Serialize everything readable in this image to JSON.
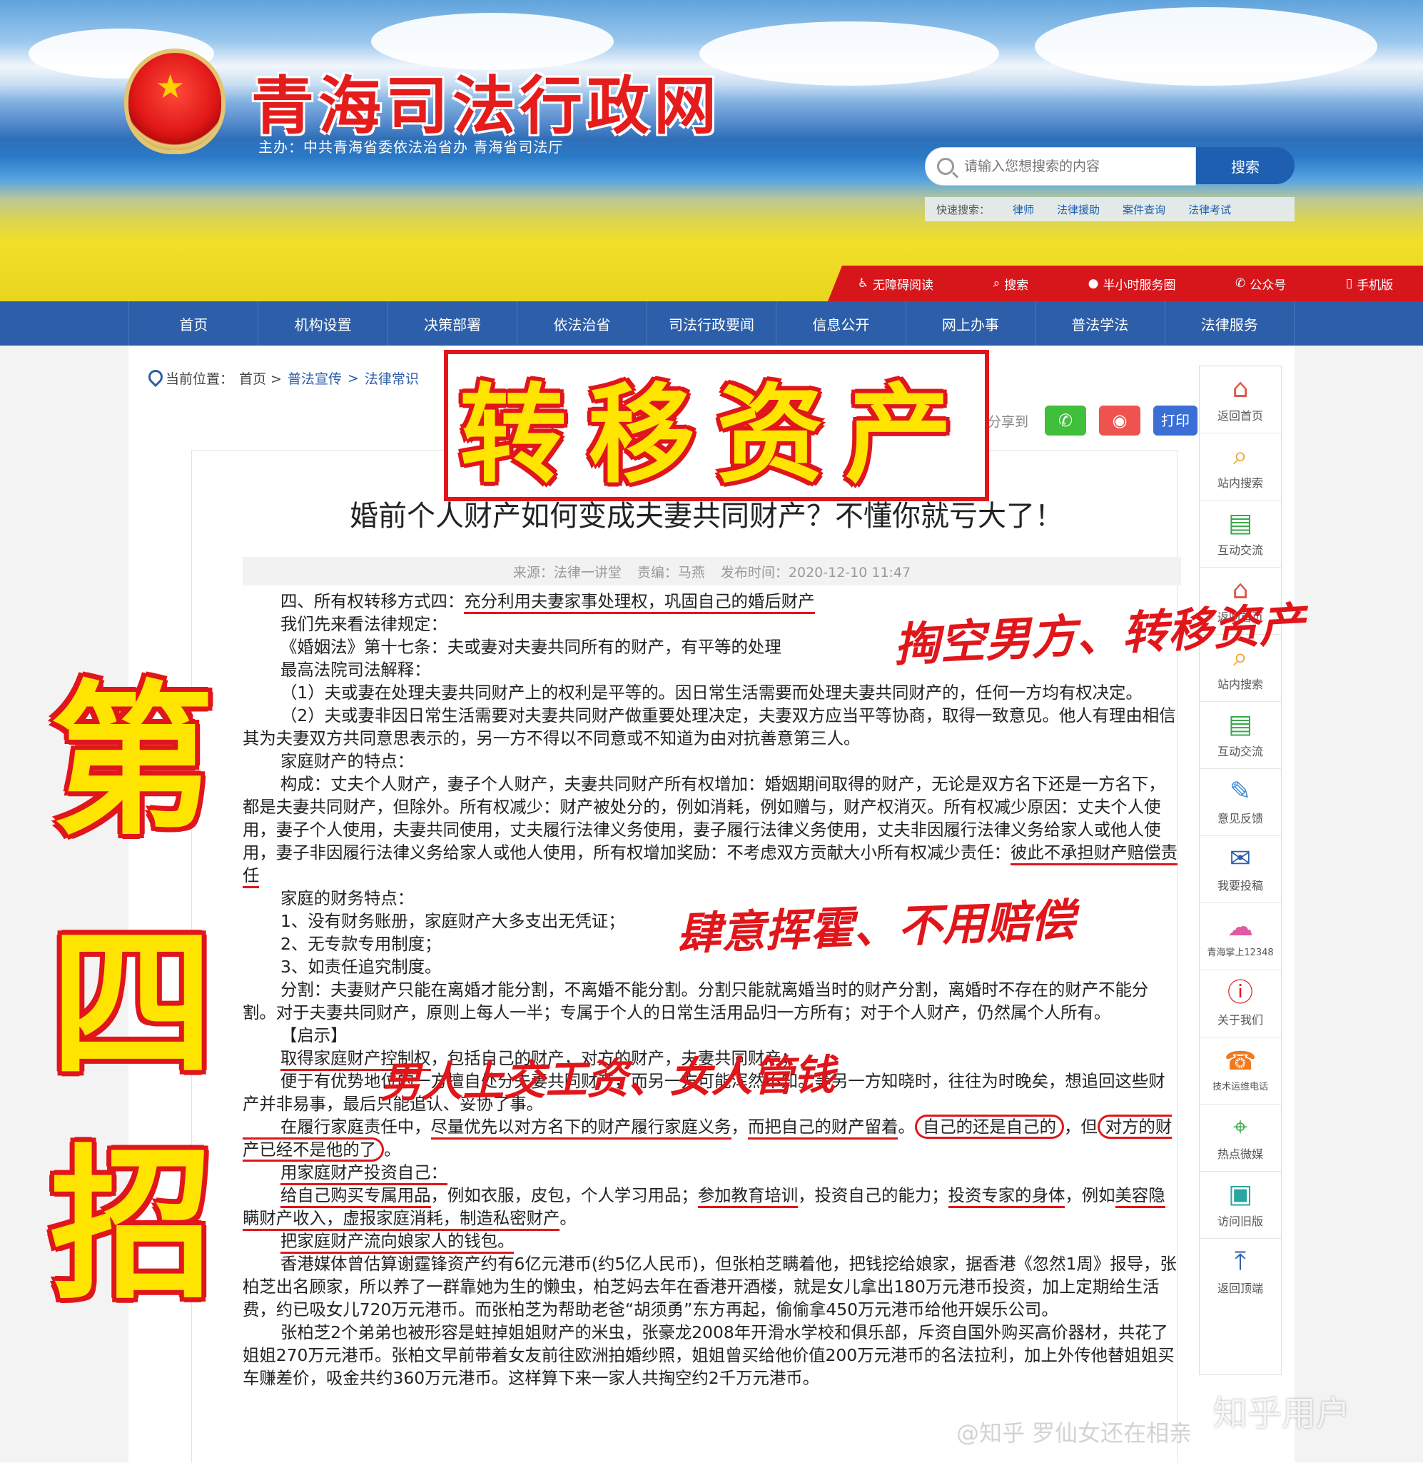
{
  "site": {
    "title": "青海司法行政网",
    "host": "主办：中共青海省委依法治省办  青海省司法厅"
  },
  "search": {
    "placeholder": "请输入您想搜索的内容",
    "button": "搜索",
    "quick_label": "快速搜索：",
    "quick_links": [
      "律师",
      "法律援助",
      "案件查询",
      "法律考试"
    ]
  },
  "util_bar": [
    "无障碍阅读",
    "搜索",
    "半小时服务圈",
    "公众号",
    "手机版"
  ],
  "nav": [
    "首页",
    "机构设置",
    "决策部署",
    "依法治省",
    "司法行政要闻",
    "信息公开",
    "网上办事",
    "普法学法",
    "法律服务"
  ],
  "breadcrumb": {
    "label": "当前位置：",
    "home": "首页 >",
    "l1": "普法宣传",
    "sep": ">",
    "l2": "法律常识"
  },
  "share": {
    "label": "分享到",
    "print": "打印"
  },
  "article": {
    "title": "婚前个人财产如何变成夫妻共同财产？不懂你就亏大了！",
    "source": "来源：法律一讲堂",
    "editor": "责编：马燕",
    "time": "发布时间：2020-12-10 11:47",
    "p1a": "四、所有权转移方式四：",
    "p1b": "充分利用夫妻家事处理权，巩固自己的婚后财产",
    "p2": "我们先来看法律规定：",
    "p3": "《婚姻法》第十七条：夫或妻对夫妻共同所有的财产，有平等的处理",
    "p4": "最高法院司法解释：",
    "p5": "（1）夫或妻在处理夫妻共同财产上的权利是平等的。因日常生活需要而处理夫妻共同财产的，任何一方均有权决定。",
    "p6": "（2）夫或妻非因日常生活需要对夫妻共同财产做重要处理决定，夫妻双方应当平等协商，取得一致意见。他人有理由相信其为夫妻双方共同意思表示的，另一方不得以不同意或不知道为由对抗善意第三人。",
    "p7": "家庭财产的特点：",
    "p8a": "构成：丈夫个人财产，妻子个人财产，夫妻共同财产所有权增加：婚姻期间取得的财产，无论是双方名下还是一方名下，都是夫妻共同财产，但除外。所有权减少：财产被处分的，例如消耗，例如赠与，财产权消灭。所有权减少原因：丈夫个人使用，妻子个人使用，夫妻共同使用，丈夫履行法律义务使用，妻子履行法律义务使用，丈夫非因履行法律义务给家人或他人使用，妻子非因履行法律义务给家人或他人使用，所有权增加奖励：不考虑双方贡献大小所有权减少责任：",
    "p8b": "彼此不承担财产赔偿责任",
    "p9": "家庭的财务特点：",
    "p10": "1、没有财务账册，家庭财产大多支出无凭证；",
    "p11": "2、无专款专用制度；",
    "p12": "3、如责任追究制度。",
    "p13": "分割：夫妻财产只能在离婚才能分割，不离婚不能分割。分割只能就离婚当时的财产分割，离婚时不存在的财产不能分割。对于夫妻共同财产，原则上每人一半；专属于个人的日常生活用品归一方所有；对于个人财产，仍然属个人所有。",
    "p14": "【启示】",
    "p15a": "取得家庭财产控制权",
    "p15b": "，包括自己的财产，对方的财产，夫妻共同财产；",
    "p16": "便于有优势地位的一方擅自处分夫妻共同财产，而另一方可能浑然不知。等另一方知晓时，往往为时晚矣，想追回这些财产并非易事，最后只能追认、妥协了事。",
    "p17a": "在履行家庭责任中，",
    "p17b": "尽量优先以对方名下的财产履行家庭义务",
    "p17c": "，",
    "p17d": "而把自己的财产留着",
    "p17e": "。",
    "p17f": "自己的还是自己的",
    "p17g": "，但",
    "p17h": "对方的财产已经不是他的了",
    "p17i": "。",
    "p18": "用家庭财产投资自己：",
    "p19a": "给自己购买专属用品",
    "p19b": "，例如衣服，皮包，个人学习用品；",
    "p19c": "参加教育培训",
    "p19d": "，投资自己的能力；",
    "p19e": "投资专家的身体",
    "p19f": "，例如",
    "p19g": "美容隐瞒财产收入，虚报家庭消耗，制造私密财产",
    "p19h": "。",
    "p20": "把家庭财产流向娘家人的钱包。",
    "p21": "香港媒体曾估算谢霆锋资产约有6亿元港币(约5亿人民币)，但张柏芝瞒着他，把钱挖给娘家，据香港《忽然1周》报导，张柏芝出名顾家，所以养了一群靠她为生的懒虫，柏芝妈去年在香港开酒楼，就是女儿拿出180万元港币投资，加上定期给生活费，约已吸女儿720万元港币。而张柏芝为帮助老爸“胡须勇”东方再起，偷偷拿450万元港币给他开娱乐公司。",
    "p22": "张柏芝2个弟弟也被形容是蛀掉姐姐财产的米虫，张豪龙2008年开滑水学校和俱乐部，斥资自国外购买高价器材，共花了姐姐270万元港币。张柏文早前带着女友前往欧洲拍婚纱照，姐姐曾买给他价值200万元港币的名法拉利，加上外传他替姐姐买车赚差价，吸金共约360万元港币。这样算下来一家人共掏空约2千万元港币。"
  },
  "sidebar": [
    {
      "label": "返回首页",
      "icon": "home-icon"
    },
    {
      "label": "站内搜索",
      "icon": "search-icon"
    },
    {
      "label": "互动交流",
      "icon": "chat-icon"
    },
    {
      "label": "返回首页",
      "icon": "home-icon"
    },
    {
      "label": "站内搜索",
      "icon": "search-icon"
    },
    {
      "label": "互动交流",
      "icon": "chat-icon"
    },
    {
      "label": "意见反馈",
      "icon": "feedback-icon"
    },
    {
      "label": "我要投稿",
      "icon": "mail-icon"
    },
    {
      "label": "青海掌上12348",
      "icon": "bubble-icon"
    },
    {
      "label": "关于我们",
      "icon": "info-icon"
    },
    {
      "label": "技术运维电话",
      "icon": "phone-icon"
    },
    {
      "label": "热点微媒",
      "icon": "satellite-icon"
    },
    {
      "label": "访问旧版",
      "icon": "old-version-icon"
    },
    {
      "label": "返回顶端",
      "icon": "top-icon"
    }
  ],
  "annotations": {
    "stamp": "转移资产",
    "big1": "第",
    "big2": "四",
    "big3": "招",
    "hand1": "掏空男方、转移资产",
    "hand2": "肆意挥霍、不用赔偿",
    "hand3": "男人上交工资、女人管钱"
  },
  "watermark": {
    "main": "知乎用户",
    "sub": "@知乎 罗仙女还在相亲"
  },
  "colors": {
    "brand_red": "#e0161b",
    "nav_blue": "#2c5ea9",
    "stamp_yellow": "#ffe400"
  }
}
